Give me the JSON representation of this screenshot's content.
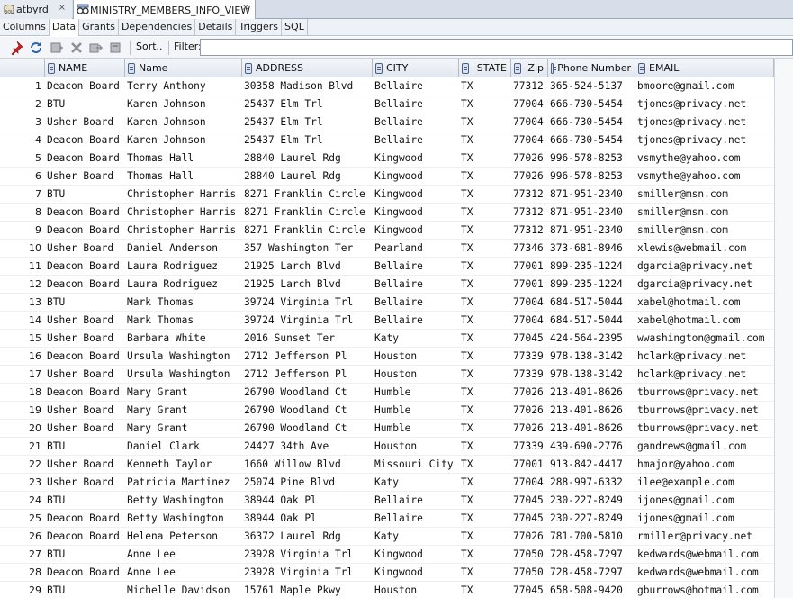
{
  "doc_tabs": [
    {
      "label": "atbyrd",
      "close": "×"
    },
    {
      "label": "MINISTRY_MEMBERS_INFO_VIEW",
      "close": "×"
    }
  ],
  "sub_tabs": [
    "Columns",
    "Data",
    "Grants",
    "Dependencies",
    "Details",
    "Triggers",
    "SQL"
  ],
  "toolbar": {
    "icons": [
      "pin-icon",
      "refresh-icon",
      "insert-row-icon",
      "delete-row-icon",
      "commit-icon",
      "rollback-icon"
    ],
    "sort_label": "Sort..",
    "filter_label": "Filter:",
    "filter_value": ""
  },
  "grid": {
    "columns": [
      "NAME",
      "Name",
      "ADDRESS",
      "CITY",
      "STATE",
      "Zip",
      "Phone Number",
      "EMAIL"
    ],
    "rows": [
      [
        "1",
        "Deacon Board",
        "Terry Anthony",
        "30358 Madison Blvd",
        "Bellaire",
        "TX",
        "77312",
        "365-524-5137",
        "bmoore@gmail.com"
      ],
      [
        "2",
        "BTU",
        "Karen Johnson",
        "25437 Elm Trl",
        "Bellaire",
        "TX",
        "77004",
        "666-730-5454",
        "tjones@privacy.net"
      ],
      [
        "3",
        "Usher Board",
        "Karen Johnson",
        "25437 Elm Trl",
        "Bellaire",
        "TX",
        "77004",
        "666-730-5454",
        "tjones@privacy.net"
      ],
      [
        "4",
        "Deacon Board",
        "Karen Johnson",
        "25437 Elm Trl",
        "Bellaire",
        "TX",
        "77004",
        "666-730-5454",
        "tjones@privacy.net"
      ],
      [
        "5",
        "Deacon Board",
        "Thomas Hall",
        "28840 Laurel Rdg",
        "Kingwood",
        "TX",
        "77026",
        "996-578-8253",
        "vsmythe@yahoo.com"
      ],
      [
        "6",
        "Usher Board",
        "Thomas Hall",
        "28840 Laurel Rdg",
        "Kingwood",
        "TX",
        "77026",
        "996-578-8253",
        "vsmythe@yahoo.com"
      ],
      [
        "7",
        "BTU",
        "Christopher Harris",
        "8271 Franklin Circle",
        "Kingwood",
        "TX",
        "77312",
        "871-951-2340",
        "smiller@msn.com"
      ],
      [
        "8",
        "Deacon Board",
        "Christopher Harris",
        "8271 Franklin Circle",
        "Kingwood",
        "TX",
        "77312",
        "871-951-2340",
        "smiller@msn.com"
      ],
      [
        "9",
        "Deacon Board",
        "Christopher Harris",
        "8271 Franklin Circle",
        "Kingwood",
        "TX",
        "77312",
        "871-951-2340",
        "smiller@msn.com"
      ],
      [
        "10",
        "Usher Board",
        "Daniel Anderson",
        "357 Washington Ter",
        "Pearland",
        "TX",
        "77346",
        "373-681-8946",
        "xlewis@webmail.com"
      ],
      [
        "11",
        "Deacon Board",
        "Laura Rodriguez",
        "21925 Larch Blvd",
        "Bellaire",
        "TX",
        "77001",
        "899-235-1224",
        "dgarcia@privacy.net"
      ],
      [
        "12",
        "Deacon Board",
        "Laura Rodriguez",
        "21925 Larch Blvd",
        "Bellaire",
        "TX",
        "77001",
        "899-235-1224",
        "dgarcia@privacy.net"
      ],
      [
        "13",
        "BTU",
        "Mark Thomas",
        "39724 Virginia Trl",
        "Bellaire",
        "TX",
        "77004",
        "684-517-5044",
        "xabel@hotmail.com"
      ],
      [
        "14",
        "Usher Board",
        "Mark Thomas",
        "39724 Virginia Trl",
        "Bellaire",
        "TX",
        "77004",
        "684-517-5044",
        "xabel@hotmail.com"
      ],
      [
        "15",
        "Usher Board",
        "Barbara White",
        "2016 Sunset Ter",
        "Katy",
        "TX",
        "77045",
        "424-564-2395",
        "wwashington@gmail.com"
      ],
      [
        "16",
        "Deacon Board",
        "Ursula Washington",
        "2712 Jefferson Pl",
        "Houston",
        "TX",
        "77339",
        "978-138-3142",
        "hclark@privacy.net"
      ],
      [
        "17",
        "Usher Board",
        "Ursula Washington",
        "2712 Jefferson Pl",
        "Houston",
        "TX",
        "77339",
        "978-138-3142",
        "hclark@privacy.net"
      ],
      [
        "18",
        "Deacon Board",
        "Mary Grant",
        "26790 Woodland Ct",
        "Humble",
        "TX",
        "77026",
        "213-401-8626",
        "tburrows@privacy.net"
      ],
      [
        "19",
        "Usher Board",
        "Mary Grant",
        "26790 Woodland Ct",
        "Humble",
        "TX",
        "77026",
        "213-401-8626",
        "tburrows@privacy.net"
      ],
      [
        "20",
        "Usher Board",
        "Mary Grant",
        "26790 Woodland Ct",
        "Humble",
        "TX",
        "77026",
        "213-401-8626",
        "tburrows@privacy.net"
      ],
      [
        "21",
        "BTU",
        "Daniel Clark",
        "24427 34th Ave",
        "Houston",
        "TX",
        "77339",
        "439-690-2776",
        "gandrews@gmail.com"
      ],
      [
        "22",
        "Usher Board",
        "Kenneth Taylor",
        "1660 Willow Blvd",
        "Missouri City",
        "TX",
        "77001",
        "913-842-4417",
        "hmajor@yahoo.com"
      ],
      [
        "23",
        "Usher Board",
        "Patricia Martinez",
        "25074 Pine Blvd",
        "Katy",
        "TX",
        "77004",
        "288-997-6332",
        "ilee@example.com"
      ],
      [
        "24",
        "BTU",
        "Betty Washington",
        "38944 Oak Pl",
        "Bellaire",
        "TX",
        "77045",
        "230-227-8249",
        "ijones@gmail.com"
      ],
      [
        "25",
        "Deacon Board",
        "Betty Washington",
        "38944 Oak Pl",
        "Bellaire",
        "TX",
        "77045",
        "230-227-8249",
        "ijones@gmail.com"
      ],
      [
        "26",
        "Deacon Board",
        "Helena Peterson",
        "36372 Laurel Rdg",
        "Katy",
        "TX",
        "77026",
        "781-700-5810",
        "rmiller@privacy.net"
      ],
      [
        "27",
        "BTU",
        "Anne Lee",
        "23928 Virginia Trl",
        "Kingwood",
        "TX",
        "77050",
        "728-458-7297",
        "kedwards@webmail.com"
      ],
      [
        "28",
        "Deacon Board",
        "Anne Lee",
        "23928 Virginia Trl",
        "Kingwood",
        "TX",
        "77050",
        "728-458-7297",
        "kedwards@webmail.com"
      ],
      [
        "29",
        "BTU",
        "Michelle Davidson",
        "15761 Maple Pkwy",
        "Houston",
        "TX",
        "77045",
        "658-508-9420",
        "gburrows@hotmail.com"
      ]
    ]
  }
}
